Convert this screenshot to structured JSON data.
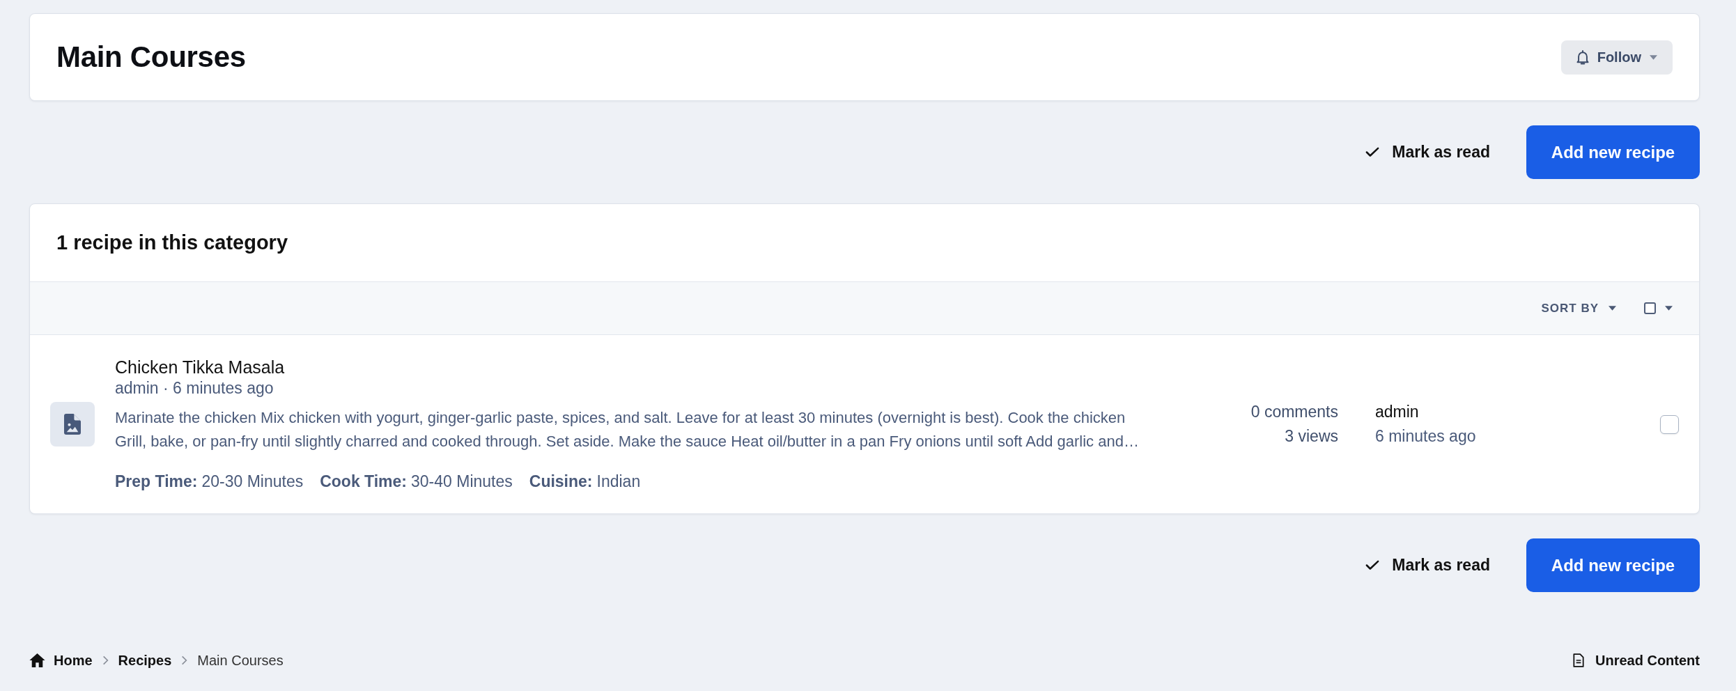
{
  "header": {
    "title": "Main Courses",
    "follow_button": "Follow"
  },
  "top_actions": {
    "mark_read": "Mark as read",
    "add_button": "Add new recipe"
  },
  "list": {
    "title": "1 recipe in this category",
    "sort_label": "SORT BY",
    "select_all": {
      "checked": false
    },
    "items": [
      {
        "title": "Chicken Tikka Masala",
        "meta": "admin · 6 minutes ago",
        "snippet": "Marinate the chicken Mix chicken with yogurt, ginger-garlic paste, spices, and salt. Leave for at least 30 minutes (overnight is best). Cook the chicken Grill, bake, or pan-fry until slightly charred and cooked through. Set aside. Make the sauce Heat oil/butter in a pan Fry onions until soft Add garlic and…",
        "fields": [
          {
            "label": "Prep Time:",
            "value": "20-30 Minutes"
          },
          {
            "label": "Cook Time:",
            "value": "30-40 Minutes"
          },
          {
            "label": "Cuisine:",
            "value": "Indian"
          }
        ],
        "comments": "0 comments",
        "views": "3 views",
        "last_author": "admin",
        "last_time": "6 minutes ago",
        "selected": false
      }
    ]
  },
  "bottom_actions": {
    "mark_read": "Mark as read",
    "add_button": "Add new recipe"
  },
  "breadcrumb": [
    {
      "label": "Home",
      "current": false
    },
    {
      "label": "Recipes",
      "current": false
    },
    {
      "label": "Main Courses",
      "current": true
    }
  ],
  "footer_link": "Unread Content"
}
